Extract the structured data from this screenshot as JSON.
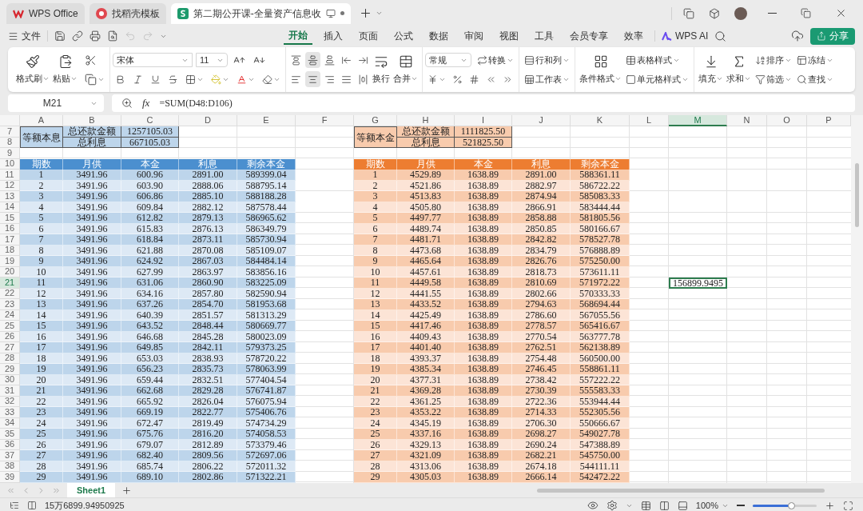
{
  "tabs": [
    {
      "label": "WPS Office",
      "selected": false
    },
    {
      "label": "找稻壳模板",
      "selected": false
    },
    {
      "label": "第二期公开课-全量资产信息收",
      "selected": true
    }
  ],
  "menu": {
    "file": "文件",
    "tabs": [
      {
        "label": "开始",
        "selected": true
      },
      {
        "label": "插入",
        "selected": false
      },
      {
        "label": "页面",
        "selected": false
      },
      {
        "label": "公式",
        "selected": false
      },
      {
        "label": "数据",
        "selected": false
      },
      {
        "label": "审阅",
        "selected": false
      },
      {
        "label": "视图",
        "selected": false
      },
      {
        "label": "工具",
        "selected": false
      },
      {
        "label": "会员专享",
        "selected": false
      },
      {
        "label": "效率",
        "selected": false
      }
    ],
    "ai": "WPS AI",
    "share": "分享"
  },
  "ribbon": {
    "format_painter": "格式刷",
    "paste": "粘贴",
    "font": "宋体",
    "size": "11",
    "vertical_align": [
      {
        "selected": false
      },
      {
        "selected": true
      },
      {
        "selected": false
      }
    ],
    "horizontal_align": [
      {
        "selected": false
      },
      {
        "selected": true
      },
      {
        "selected": false
      },
      {
        "selected": false
      }
    ],
    "wrap": "换行",
    "merge": "合并",
    "number_format": "常规",
    "convert": "转换",
    "rows_cols": "行和列",
    "worksheet": "工作表",
    "conditional": "条件格式",
    "table_style": "表格样式",
    "cell_style": "单元格样式",
    "fill": "填充",
    "sum": "求和",
    "sort": "排序",
    "filter": "筛选",
    "freeze": "冻结",
    "find": "查找"
  },
  "formula_bar": {
    "cell": "M21",
    "fx": "fx",
    "formula": "=SUM(D48:D106)"
  },
  "columns": [
    {
      "label": "A",
      "selected": false
    },
    {
      "label": "B",
      "selected": false
    },
    {
      "label": "C",
      "selected": false
    },
    {
      "label": "D",
      "selected": false
    },
    {
      "label": "E",
      "selected": false
    },
    {
      "label": "F",
      "selected": false
    },
    {
      "label": "G",
      "selected": false
    },
    {
      "label": "H",
      "selected": false
    },
    {
      "label": "I",
      "selected": false
    },
    {
      "label": "J",
      "selected": false
    },
    {
      "label": "K",
      "selected": false
    },
    {
      "label": "L",
      "selected": false
    },
    {
      "label": "M",
      "selected": true
    },
    {
      "label": "N",
      "selected": false
    },
    {
      "label": "O",
      "selected": false
    },
    {
      "label": "P",
      "selected": false
    }
  ],
  "row_numbers": [
    {
      "label": "7",
      "selected": false
    },
    {
      "label": "8",
      "selected": false
    },
    {
      "label": "9",
      "selected": false
    },
    {
      "label": "10",
      "selected": false
    },
    {
      "label": "11",
      "selected": false
    },
    {
      "label": "12",
      "selected": false
    },
    {
      "label": "13",
      "selected": false
    },
    {
      "label": "14",
      "selected": false
    },
    {
      "label": "15",
      "selected": false
    },
    {
      "label": "16",
      "selected": false
    },
    {
      "label": "17",
      "selected": false
    },
    {
      "label": "18",
      "selected": false
    },
    {
      "label": "19",
      "selected": false
    },
    {
      "label": "20",
      "selected": false
    },
    {
      "label": "21",
      "selected": true
    },
    {
      "label": "22",
      "selected": false
    },
    {
      "label": "23",
      "selected": false
    },
    {
      "label": "24",
      "selected": false
    },
    {
      "label": "25",
      "selected": false
    },
    {
      "label": "26",
      "selected": false
    },
    {
      "label": "27",
      "selected": false
    },
    {
      "label": "28",
      "selected": false
    },
    {
      "label": "29",
      "selected": false
    },
    {
      "label": "30",
      "selected": false
    },
    {
      "label": "31",
      "selected": false
    },
    {
      "label": "32",
      "selected": false
    },
    {
      "label": "33",
      "selected": false
    },
    {
      "label": "34",
      "selected": false
    },
    {
      "label": "35",
      "selected": false
    },
    {
      "label": "36",
      "selected": false
    },
    {
      "label": "37",
      "selected": false
    },
    {
      "label": "38",
      "selected": false
    },
    {
      "label": "39",
      "selected": false
    }
  ],
  "left_table": {
    "title": "等额本息",
    "summary": [
      {
        "label": "总还款金额",
        "value": "1257105.03"
      },
      {
        "label": "总利息",
        "value": "667105.03"
      }
    ],
    "headers": [
      "期数",
      "月供",
      "本金",
      "利息",
      "剩余本金"
    ],
    "rows": [
      [
        "1",
        "3491.96",
        "600.96",
        "2891.00",
        "589399.04"
      ],
      [
        "2",
        "3491.96",
        "603.90",
        "2888.06",
        "588795.14"
      ],
      [
        "3",
        "3491.96",
        "606.86",
        "2885.10",
        "588188.28"
      ],
      [
        "4",
        "3491.96",
        "609.84",
        "2882.12",
        "587578.44"
      ],
      [
        "5",
        "3491.96",
        "612.82",
        "2879.13",
        "586965.62"
      ],
      [
        "6",
        "3491.96",
        "615.83",
        "2876.13",
        "586349.79"
      ],
      [
        "7",
        "3491.96",
        "618.84",
        "2873.11",
        "585730.94"
      ],
      [
        "8",
        "3491.96",
        "621.88",
        "2870.08",
        "585109.07"
      ],
      [
        "9",
        "3491.96",
        "624.92",
        "2867.03",
        "584484.14"
      ],
      [
        "10",
        "3491.96",
        "627.99",
        "2863.97",
        "583856.16"
      ],
      [
        "11",
        "3491.96",
        "631.06",
        "2860.90",
        "583225.09"
      ],
      [
        "12",
        "3491.96",
        "634.16",
        "2857.80",
        "582590.94"
      ],
      [
        "13",
        "3491.96",
        "637.26",
        "2854.70",
        "581953.68"
      ],
      [
        "14",
        "3491.96",
        "640.39",
        "2851.57",
        "581313.29"
      ],
      [
        "15",
        "3491.96",
        "643.52",
        "2848.44",
        "580669.77"
      ],
      [
        "16",
        "3491.96",
        "646.68",
        "2845.28",
        "580023.09"
      ],
      [
        "17",
        "3491.96",
        "649.85",
        "2842.11",
        "579373.25"
      ],
      [
        "18",
        "3491.96",
        "653.03",
        "2838.93",
        "578720.22"
      ],
      [
        "19",
        "3491.96",
        "656.23",
        "2835.73",
        "578063.99"
      ],
      [
        "20",
        "3491.96",
        "659.44",
        "2832.51",
        "577404.54"
      ],
      [
        "21",
        "3491.96",
        "662.68",
        "2829.28",
        "576741.87"
      ],
      [
        "22",
        "3491.96",
        "665.92",
        "2826.04",
        "576075.94"
      ],
      [
        "23",
        "3491.96",
        "669.19",
        "2822.77",
        "575406.76"
      ],
      [
        "24",
        "3491.96",
        "672.47",
        "2819.49",
        "574734.29"
      ],
      [
        "25",
        "3491.96",
        "675.76",
        "2816.20",
        "574058.53"
      ],
      [
        "26",
        "3491.96",
        "679.07",
        "2812.89",
        "573379.46"
      ],
      [
        "27",
        "3491.96",
        "682.40",
        "2809.56",
        "572697.06"
      ],
      [
        "28",
        "3491.96",
        "685.74",
        "2806.22",
        "572011.32"
      ],
      [
        "29",
        "3491.96",
        "689.10",
        "2802.86",
        "571322.21"
      ]
    ]
  },
  "right_table": {
    "title": "等额本金",
    "summary": [
      {
        "label": "总还款金额",
        "value": "1111825.50"
      },
      {
        "label": "总利息",
        "value": "521825.50"
      }
    ],
    "headers": [
      "期数",
      "月供",
      "本金",
      "利息",
      "剩余本金"
    ],
    "rows": [
      [
        "1",
        "4529.89",
        "1638.89",
        "2891.00",
        "588361.11"
      ],
      [
        "2",
        "4521.86",
        "1638.89",
        "2882.97",
        "586722.22"
      ],
      [
        "3",
        "4513.83",
        "1638.89",
        "2874.94",
        "585083.33"
      ],
      [
        "4",
        "4505.80",
        "1638.89",
        "2866.91",
        "583444.44"
      ],
      [
        "5",
        "4497.77",
        "1638.89",
        "2858.88",
        "581805.56"
      ],
      [
        "6",
        "4489.74",
        "1638.89",
        "2850.85",
        "580166.67"
      ],
      [
        "7",
        "4481.71",
        "1638.89",
        "2842.82",
        "578527.78"
      ],
      [
        "8",
        "4473.68",
        "1638.89",
        "2834.79",
        "576888.89"
      ],
      [
        "9",
        "4465.64",
        "1638.89",
        "2826.76",
        "575250.00"
      ],
      [
        "10",
        "4457.61",
        "1638.89",
        "2818.73",
        "573611.11"
      ],
      [
        "11",
        "4449.58",
        "1638.89",
        "2810.69",
        "571972.22"
      ],
      [
        "12",
        "4441.55",
        "1638.89",
        "2802.66",
        "570333.33"
      ],
      [
        "13",
        "4433.52",
        "1638.89",
        "2794.63",
        "568694.44"
      ],
      [
        "14",
        "4425.49",
        "1638.89",
        "2786.60",
        "567055.56"
      ],
      [
        "15",
        "4417.46",
        "1638.89",
        "2778.57",
        "565416.67"
      ],
      [
        "16",
        "4409.43",
        "1638.89",
        "2770.54",
        "563777.78"
      ],
      [
        "17",
        "4401.40",
        "1638.89",
        "2762.51",
        "562138.89"
      ],
      [
        "18",
        "4393.37",
        "1638.89",
        "2754.48",
        "560500.00"
      ],
      [
        "19",
        "4385.34",
        "1638.89",
        "2746.45",
        "558861.11"
      ],
      [
        "20",
        "4377.31",
        "1638.89",
        "2738.42",
        "557222.22"
      ],
      [
        "21",
        "4369.28",
        "1638.89",
        "2730.39",
        "555583.33"
      ],
      [
        "22",
        "4361.25",
        "1638.89",
        "2722.36",
        "553944.44"
      ],
      [
        "23",
        "4353.22",
        "1638.89",
        "2714.33",
        "552305.56"
      ],
      [
        "24",
        "4345.19",
        "1638.89",
        "2706.30",
        "550666.67"
      ],
      [
        "25",
        "4337.16",
        "1638.89",
        "2698.27",
        "549027.78"
      ],
      [
        "26",
        "4329.13",
        "1638.89",
        "2690.24",
        "547388.89"
      ],
      [
        "27",
        "4321.09",
        "1638.89",
        "2682.21",
        "545750.00"
      ],
      [
        "28",
        "4313.06",
        "1638.89",
        "2674.18",
        "544111.11"
      ],
      [
        "29",
        "4305.03",
        "1638.89",
        "2666.14",
        "542472.22"
      ]
    ]
  },
  "active_cell": {
    "value": "156899.9495"
  },
  "sheets": [
    {
      "label": "Sheet1",
      "selected": true
    }
  ],
  "status_bar": {
    "sum": "15万6899.94950925",
    "zoom": "100%",
    "zoom_level": {
      "level": 0.6
    }
  }
}
